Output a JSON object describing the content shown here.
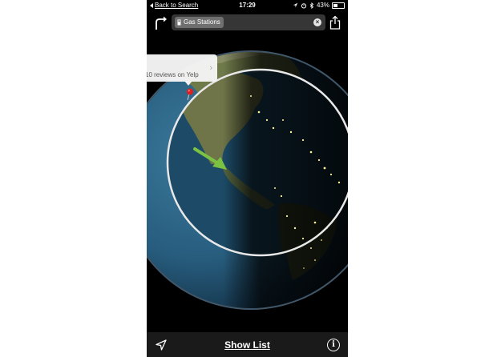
{
  "status_bar": {
    "back_label": "Back to Search",
    "time": "17:29",
    "battery": "43%",
    "battery_level": 0.43
  },
  "top_bar": {
    "search_chip": "Gas Stations",
    "clear_icon": "clear-x-icon",
    "share_icon": "share-icon",
    "directions_icon": "turn-right-arrow-icon"
  },
  "callout": {
    "reviews_text": "10 reviews on Yelp"
  },
  "bottom_bar": {
    "show_list_label": "Show List",
    "info_symbol": "i",
    "location_icon": "location-arrow-icon"
  },
  "colors": {
    "accent_arrow": "#7cc242",
    "pin": "#e02020",
    "bar_bg": "#1a1a1a"
  }
}
